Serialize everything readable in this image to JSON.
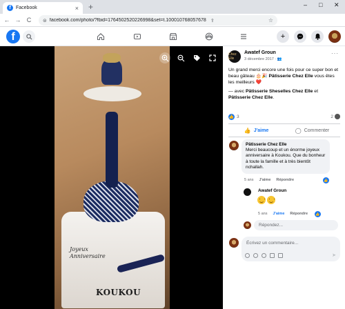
{
  "browser": {
    "tab_title": "Facebook",
    "tab_close": "×",
    "new_tab": "+",
    "url": "facebook.com/photo/?fbid=1764502520226998&set=t.100010768057678",
    "win_minimize": "–",
    "win_maximize": "□",
    "win_close": "✕",
    "nav_back": "←",
    "nav_forward": "→",
    "nav_reload": "C"
  },
  "fb_header": {
    "logo": "f",
    "nav_icons": [
      "home-icon",
      "video-icon",
      "marketplace-icon",
      "groups-icon",
      "menu-icon"
    ],
    "right_buttons": [
      "create-icon",
      "messenger-icon",
      "notifications-icon"
    ],
    "create": "+"
  },
  "photo_tools": [
    "zoom-in-icon",
    "zoom-out-icon",
    "tag-icon",
    "fullscreen-icon"
  ],
  "photo": {
    "caption_text": "KOUKOU",
    "script_line1": "Joyeux",
    "script_line2": "Anniversaire"
  },
  "post": {
    "author": "Awatef Groun",
    "date": "3 décembre 2017 · ",
    "more": "···",
    "text_part1": "Un grand merci encore une fois pour ce super bon et beau gâteau 🎂🎉 ",
    "text_bold1": "Pâtisserie Chez Elle",
    "text_part2": " vous êtes les meilleurs ❤️",
    "text_part3": "— avec ",
    "text_bold2": "Pâtisserie Sheselles Chez Elle",
    "text_and": " et ",
    "text_bold3": "Pâtisserie Chez Elle",
    "text_end": ".",
    "reactions_count": "3",
    "comments_count": "2"
  },
  "actions": {
    "like": "J'aime",
    "comment": "Commenter"
  },
  "comments": [
    {
      "author": "Pâtisserie Chez Elle",
      "text": "Merci beaucoup et un énorme joyeux anniversaire à Koukou. Que du bonheur à toute la famille et à très bientôt nchallah.",
      "time": "5 ans",
      "like": "J'aime",
      "reply": "Répondre"
    },
    {
      "author": "Awatef Groun",
      "time": "5 ans",
      "like": "J'aime",
      "reply": "Répondre"
    }
  ],
  "reply_placeholder": "Répondez...",
  "comment_placeholder": "Écrivez un commentaire...",
  "author_avatar_text": "Chez Elle"
}
